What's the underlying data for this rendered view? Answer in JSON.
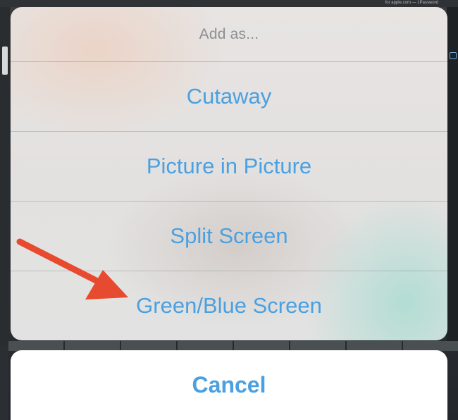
{
  "action_sheet": {
    "title": "Add as...",
    "options": [
      {
        "label": "Cutaway"
      },
      {
        "label": "Picture in Picture"
      },
      {
        "label": "Split Screen"
      },
      {
        "label": "Green/Blue Screen"
      }
    ],
    "cancel_label": "Cancel"
  },
  "background": {
    "top_text": "for apple.com — 1Password"
  },
  "annotation": {
    "arrow_color": "#e84a2f"
  },
  "colors": {
    "option_text": "#4aa0e0",
    "title_text": "#8e8e93"
  }
}
